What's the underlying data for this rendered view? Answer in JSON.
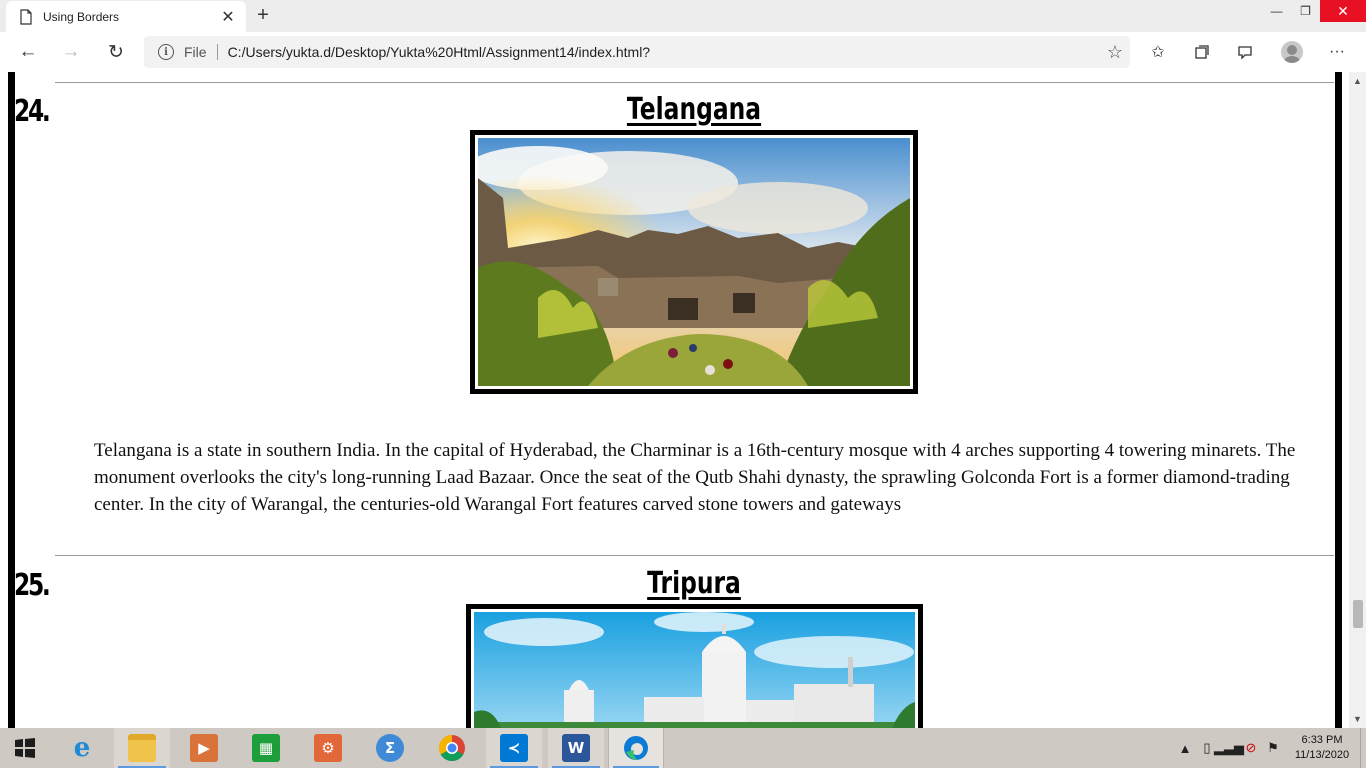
{
  "browser": {
    "tab": {
      "title": "Using Borders",
      "icon": "document-icon"
    },
    "address": {
      "scheme_label": "File",
      "url": "C:/Users/yukta.d/Desktop/Yukta%20Html/Assignment14/index.html?"
    },
    "icons": [
      "back-arrow-icon",
      "forward-arrow-icon",
      "refresh-icon",
      "info-icon",
      "favorite-star-icon",
      "favorites-icon",
      "collections-icon",
      "feedback-icon",
      "profile-icon",
      "more-icon"
    ],
    "window_controls": [
      "minimize",
      "restore",
      "close"
    ]
  },
  "content": {
    "items": [
      {
        "number": "24.",
        "title": "Telangana",
        "image": "fort-sunset-photo",
        "description": "Telangana is a state in southern India. In the capital of Hyderabad, the Charminar is a 16th-century mosque with 4 arches supporting 4 towering minarets. The monument overlooks the city's long-running Laad Bazaar. Once the seat of the Qutb Shahi dynasty, the sprawling Golconda Fort is a former diamond-trading center. In the city of Warangal, the centuries-old Warangal Fort features carved stone towers and gateways"
      },
      {
        "number": "25.",
        "title": "Tripura",
        "image": "white-palace-photo"
      }
    ]
  },
  "scrollbar": {
    "position_fraction": 0.82
  },
  "taskbar": {
    "apps": [
      "internet-explorer",
      "file-explorer",
      "media-app",
      "store",
      "office-tools",
      "math-input",
      "chrome",
      "vscode",
      "word",
      "edge"
    ],
    "active_app": "edge",
    "clock": {
      "time": "6:33 PM",
      "date": "11/13/2020"
    }
  }
}
